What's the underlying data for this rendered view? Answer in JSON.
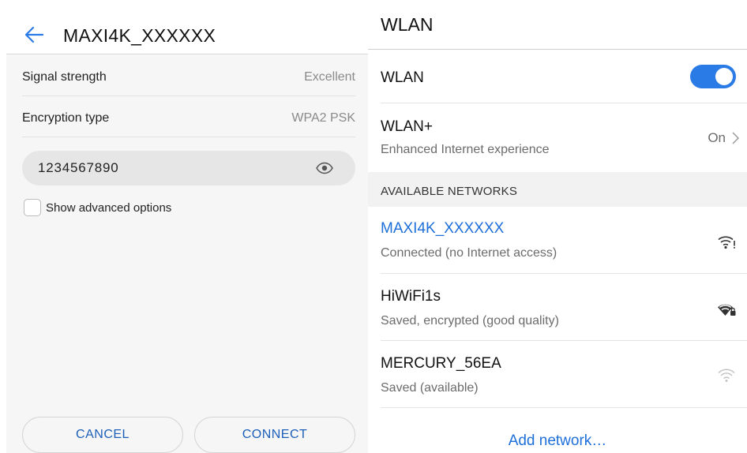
{
  "detail": {
    "title": "MAXI4K_XXXXXX",
    "rows": [
      {
        "label": "Signal strength",
        "value": "Excellent"
      },
      {
        "label": "Encryption type",
        "value": "WPA2 PSK"
      }
    ],
    "password": "1234567890",
    "advanced_label": "Show advanced options",
    "cancel_label": "CANCEL",
    "connect_label": "CONNECT"
  },
  "wlan": {
    "title": "WLAN",
    "toggle_label": "WLAN",
    "toggle_on": true,
    "plus_title": "WLAN+",
    "plus_subtitle": "Enhanced Internet experience",
    "plus_value": "On",
    "section_header": "AVAILABLE NETWORKS",
    "networks": [
      {
        "name": "MAXI4K_XXXXXX",
        "status": "Connected (no Internet access)",
        "icon": "wifi-no-internet-icon"
      },
      {
        "name": "HiWiFi1s",
        "status": "Saved, encrypted (good quality)",
        "icon": "wifi-locked-icon"
      },
      {
        "name": "MERCURY_56EA",
        "status": "Saved (available)",
        "icon": "wifi-weak-icon"
      }
    ],
    "add_network": "Add network…"
  },
  "colors": {
    "accent": "#2b7be6",
    "link": "#1e6fd9",
    "button_text": "#1c5fb8",
    "connected_network": "#1e6fd9"
  }
}
